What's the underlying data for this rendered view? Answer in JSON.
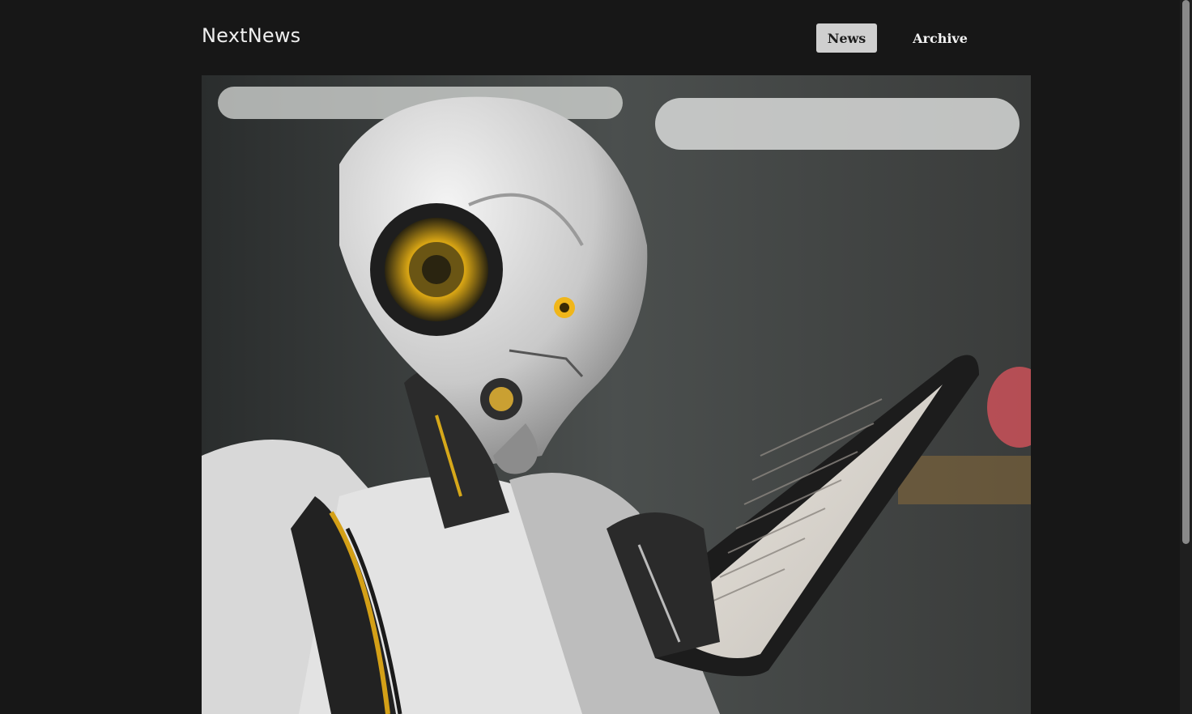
{
  "header": {
    "brand": "NextNews",
    "nav": {
      "news_label": "News",
      "archive_label": "Archive"
    }
  },
  "hero": {
    "subject": "robot-reading-tablet-image"
  }
}
